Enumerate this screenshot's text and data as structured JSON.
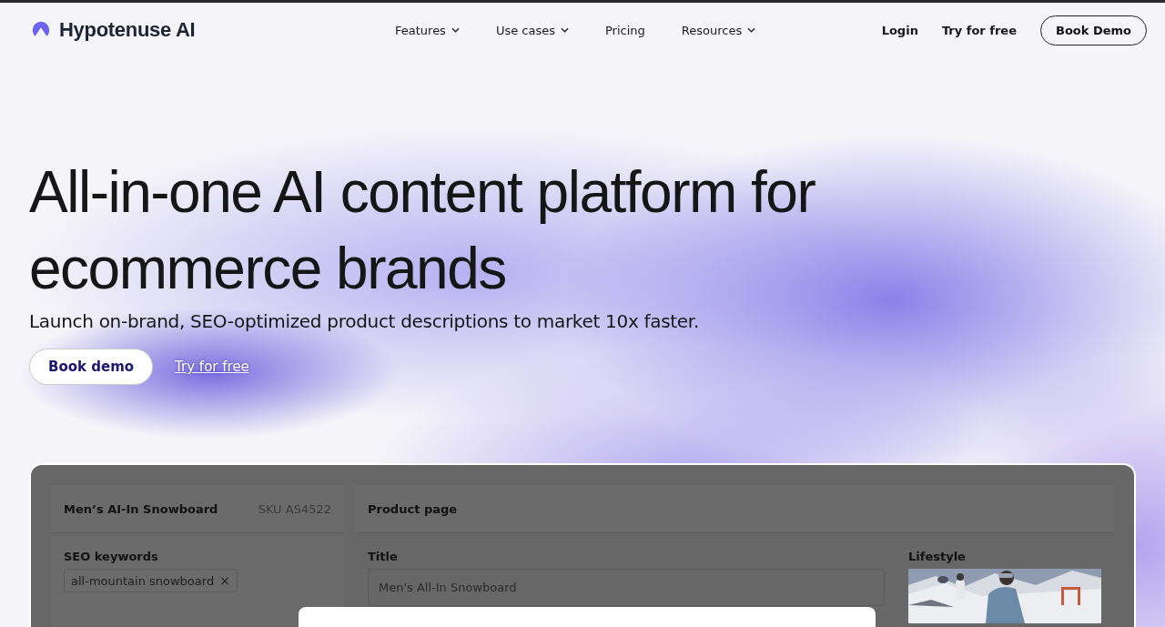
{
  "nav": {
    "brand": "Hypotenuse AI",
    "links": [
      {
        "label": "Features",
        "dropdown": true
      },
      {
        "label": "Use cases",
        "dropdown": true
      },
      {
        "label": "Pricing",
        "dropdown": false
      },
      {
        "label": "Resources",
        "dropdown": true
      }
    ],
    "actions": [
      {
        "label": "Login",
        "kind": "link"
      },
      {
        "label": "Try for free",
        "kind": "link"
      },
      {
        "label": "Book Demo",
        "kind": "outline"
      }
    ]
  },
  "hero": {
    "heading": "All-in-one AI content platform for ecommerce brands",
    "subtitle": "Launch on-brand, SEO-optimized product descriptions to market 10x faster.",
    "primary_button": "Book demo",
    "secondary_link": "Try for free"
  },
  "mockup": {
    "product": {
      "name": "Men’s AI-In Snowboard",
      "sku": "SKU AS4522"
    },
    "seo": {
      "label": "SEO keywords",
      "tags": [
        {
          "text": "all-mountain snowboard",
          "remove": "×"
        }
      ]
    },
    "page": {
      "title": "Product page",
      "field_label": "Title",
      "field_value": "Men's All-In Snowboard",
      "image_label": "Lifestyle"
    }
  }
}
